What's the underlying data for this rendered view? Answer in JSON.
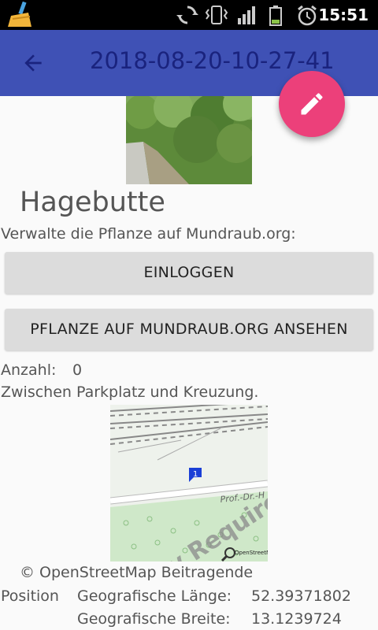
{
  "status_bar": {
    "time": "15:51"
  },
  "app_bar": {
    "title": "2018-08-20-10-27-41"
  },
  "plant": {
    "name": "Hagebutte",
    "manage_text": "Verwalte die Pflanze auf Mundraub.org:",
    "count_label": "Anzahl:",
    "count_value": "0",
    "description": "Zwischen Parkplatz und Kreuzung."
  },
  "buttons": {
    "login": "EINLOGGEN",
    "view": "PFLANZE AUF MUNDRAUB.ORG ANSEHEN"
  },
  "map": {
    "street_label": "Prof.-Dr.-H",
    "watermark": "Key Required",
    "marker_number": "1",
    "logo_text": "OpenStreetMap",
    "attribution": "© OpenStreetMap Beitragende"
  },
  "position": {
    "label": "Position",
    "longitude_label": "Geografische Länge:",
    "longitude_value": "52.39371802",
    "latitude_label": "Geografische Breite:",
    "latitude_value": "13.1239724"
  },
  "colors": {
    "primary": "#3f51b5",
    "fab": "#ec407a",
    "title_text": "#1a237e"
  },
  "icons": [
    "broom-icon",
    "sync-icon",
    "vibrate-icon",
    "signal-icon",
    "battery-icon",
    "alarm-icon",
    "back-arrow-icon",
    "pencil-icon",
    "map-marker-icon"
  ]
}
